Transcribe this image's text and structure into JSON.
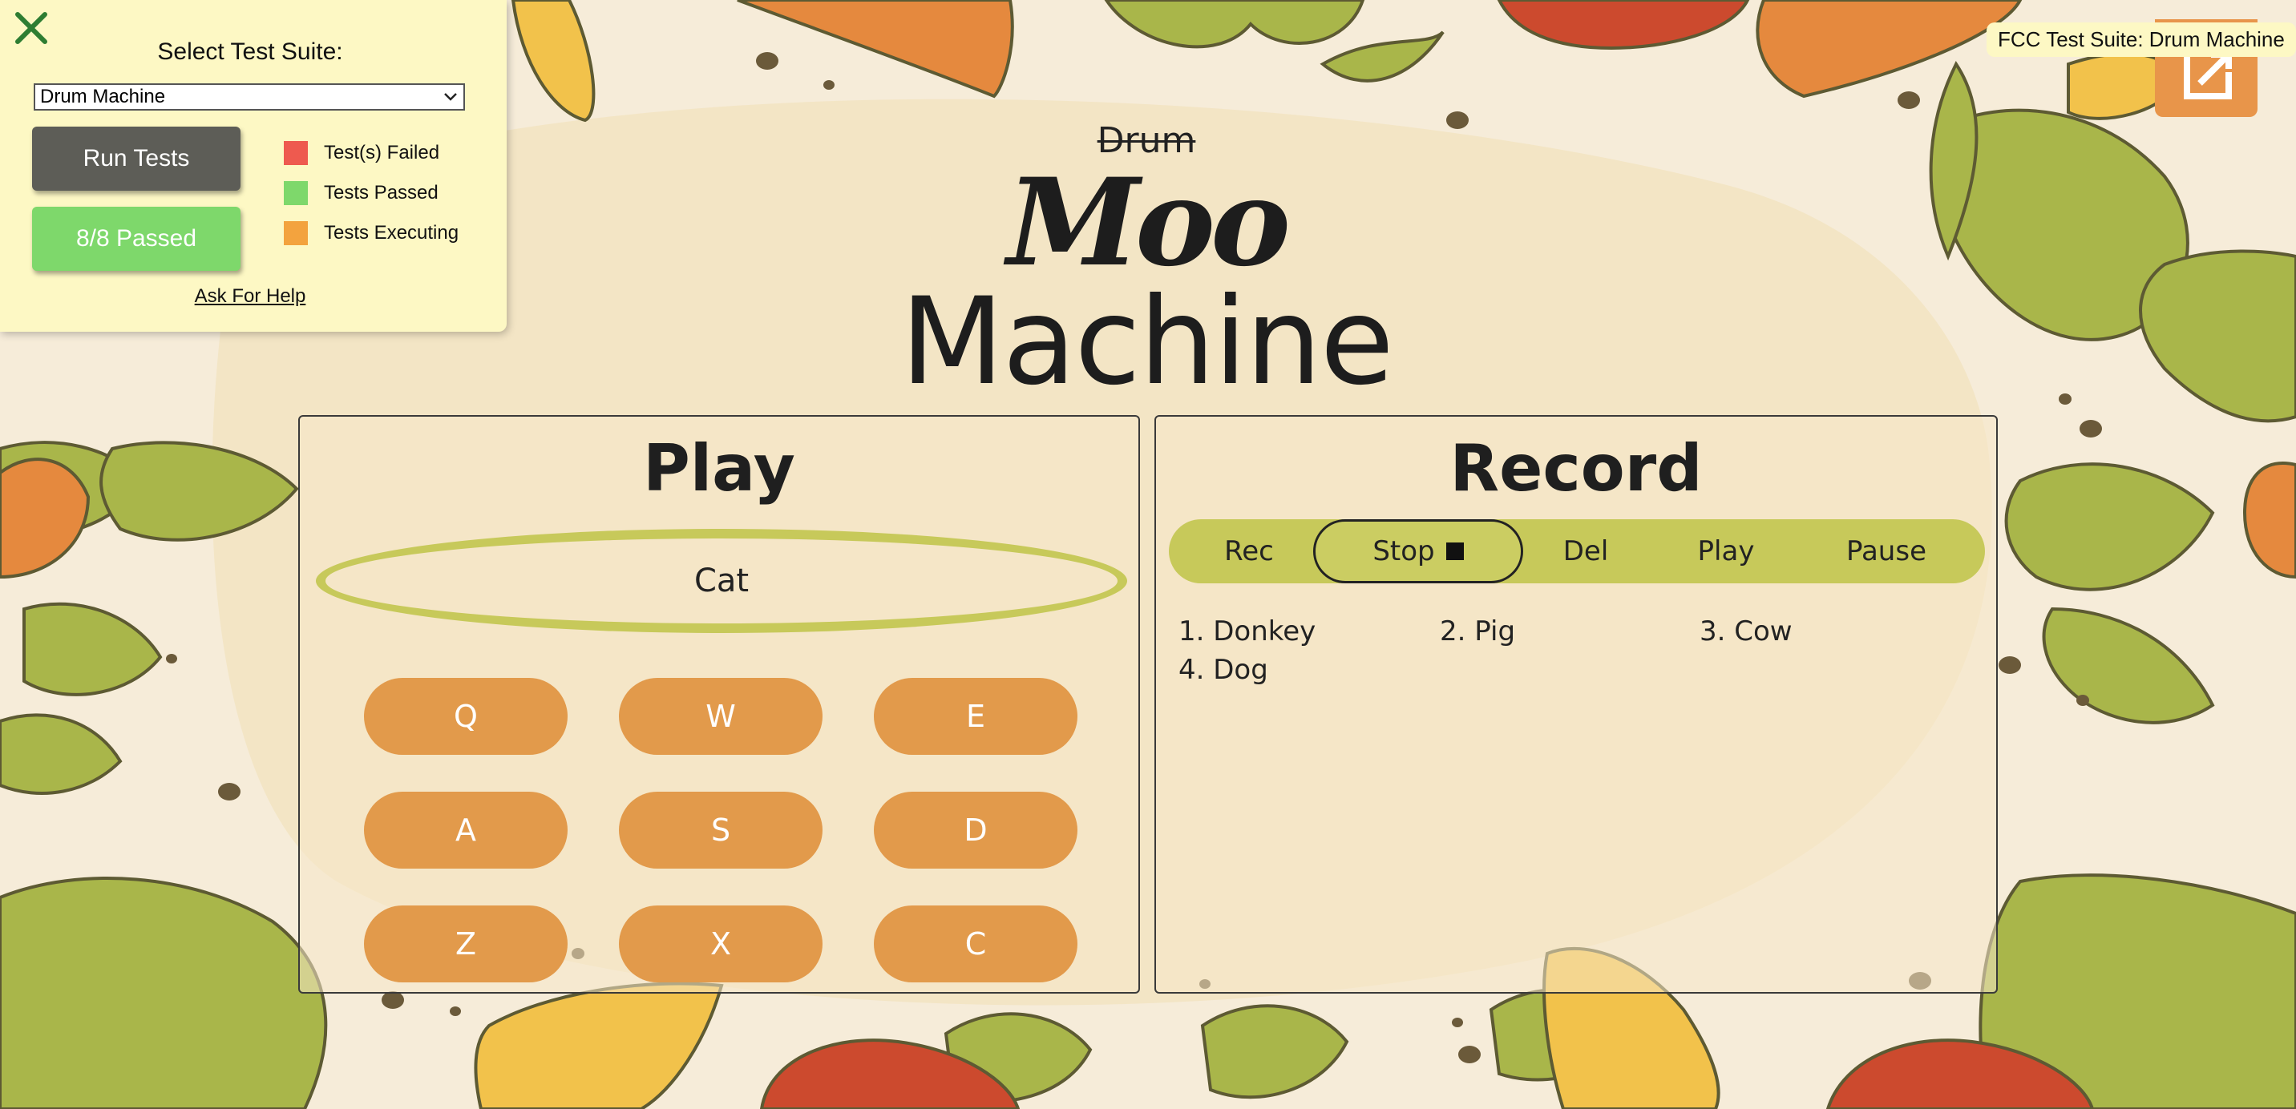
{
  "title": {
    "drum": "Drum",
    "moo": "Moo",
    "machine": "Machine"
  },
  "play_panel": {
    "heading": "Play",
    "display": "Cat",
    "pads": [
      "Q",
      "W",
      "E",
      "A",
      "S",
      "D",
      "Z",
      "X",
      "C"
    ]
  },
  "record_panel": {
    "heading": "Record",
    "controls": {
      "rec": "Rec",
      "stop": "Stop",
      "del": "Del",
      "play": "Play",
      "pause": "Pause"
    },
    "sequence": [
      "1. Donkey",
      "2. Pig",
      "3. Cow",
      "4. Dog"
    ]
  },
  "fcc": {
    "select_label": "Select Test Suite:",
    "selected_suite": "Drum Machine",
    "run_tests": "Run Tests",
    "passed": "8/8 Passed",
    "legend": {
      "failed": "Test(s) Failed",
      "passed": "Tests Passed",
      "executing": "Tests Executing"
    },
    "help": "Ask For Help",
    "tooltip": "FCC Test Suite: Drum Machine"
  },
  "colors": {
    "background": "#f6ecd9",
    "pad": "#e29a4b",
    "accent_bar": "#c7c95a",
    "failed": "#ee5a4f",
    "passed": "#7ed86b",
    "executing": "#f3a33e",
    "fcc_panel": "#fdf8c4"
  },
  "icons": {
    "close": "close-icon",
    "stop": "stop-square-icon",
    "dropdown": "chevron-down-icon",
    "fcc_toggle": "external-panel-icon"
  }
}
